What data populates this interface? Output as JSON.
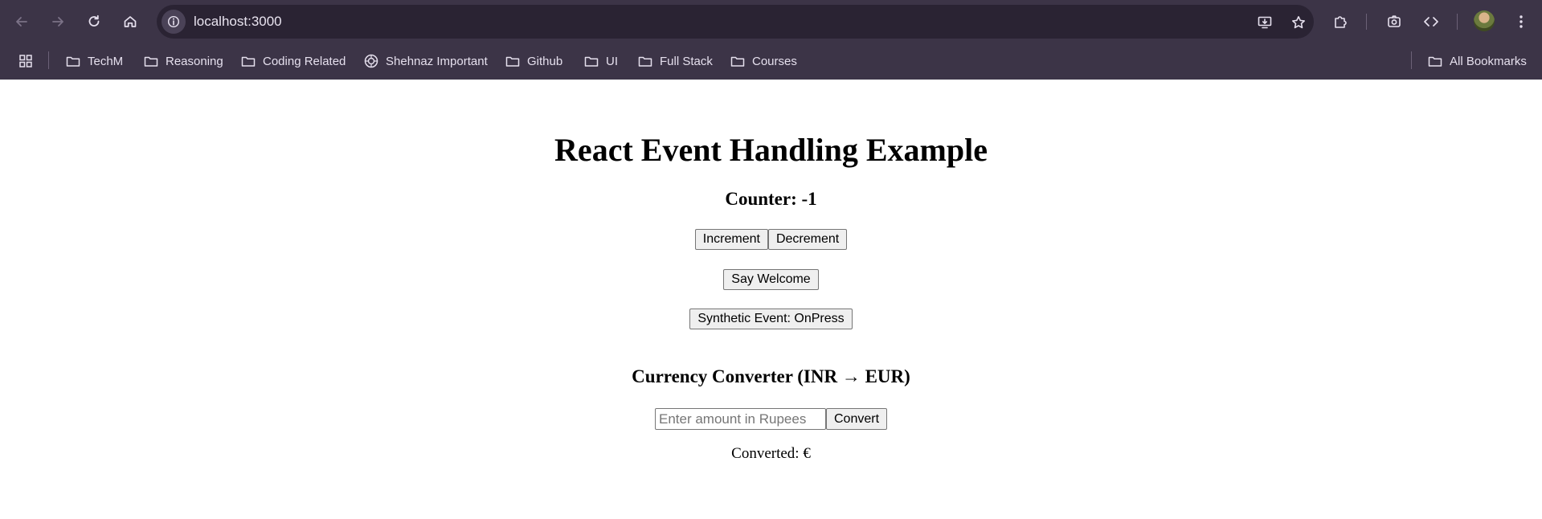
{
  "browser": {
    "url": "localhost:3000",
    "icons": {
      "back": "back-arrow-icon",
      "forward": "forward-arrow-icon",
      "reload": "reload-icon",
      "home": "home-icon",
      "site_info": "info-icon",
      "install": "install-app-icon",
      "bookmark_star": "star-icon",
      "extensions": "puzzle-icon",
      "lens": "camera-search-icon",
      "devtools": "code-icon",
      "menu": "kebab-menu-icon"
    },
    "theme": {
      "chrome_bg": "#3c3447",
      "omnibox_bg": "#2a2333",
      "text": "#e6e0ee"
    }
  },
  "bookmarks": {
    "items": [
      {
        "label": "TechM",
        "icon": "folder-icon"
      },
      {
        "label": "Reasoning",
        "icon": "folder-icon"
      },
      {
        "label": "Coding Related",
        "icon": "folder-icon"
      },
      {
        "label": "Shehnaz Important",
        "icon": "globe-icon"
      },
      {
        "label": "Github",
        "icon": "folder-icon"
      },
      {
        "label": "UI",
        "icon": "folder-icon"
      },
      {
        "label": "Full Stack",
        "icon": "folder-icon"
      },
      {
        "label": "Courses",
        "icon": "folder-icon"
      }
    ],
    "all_bookmarks": "All Bookmarks"
  },
  "app": {
    "title": "React Event Handling Example",
    "counter_label": "Counter: -1",
    "increment_label": "Increment",
    "decrement_label": "Decrement",
    "welcome_label": "Say Welcome",
    "synthetic_label": "Synthetic Event: OnPress",
    "converter_title": "Currency Converter (INR → EUR)",
    "amount_value": "",
    "amount_placeholder": "Enter amount in Rupees",
    "convert_label": "Convert",
    "converted_text": "Converted: €"
  }
}
